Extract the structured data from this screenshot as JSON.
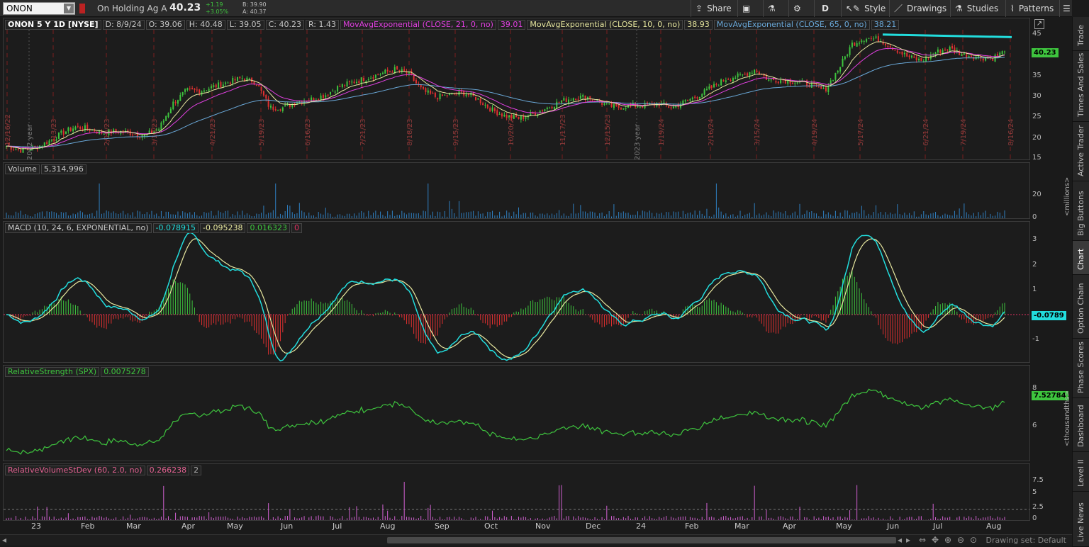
{
  "toolbar": {
    "symbol": "ONON",
    "company": "On Holding Ag A",
    "last": "40.23",
    "change": "+1.19",
    "change_pct": "+3.05%",
    "bid": "B: 39.90",
    "ask": "A: 40.37",
    "buttons": {
      "share": "Share",
      "period": "D",
      "style": "Style",
      "drawings": "Drawings",
      "studies": "Studies",
      "patterns": "Patterns"
    }
  },
  "side_tabs": [
    "Trade",
    "Times And Sales",
    "Active Trader",
    "Big Buttons",
    "Chart",
    "Option Chain",
    "Phase Scores",
    "Dashboard",
    "Level II",
    "Live News"
  ],
  "price_pane": {
    "header": {
      "title": "ONON 5 Y 1D [NYSE]",
      "date": "D: 8/9/24",
      "open": "O: 39.06",
      "high": "H: 40.48",
      "low": "L: 39.05",
      "close": "C: 40.23",
      "range": "R: 1.43",
      "ema21_label": "MovAvgExponential (CLOSE, 21, 0, no)",
      "ema21_value": "39.01",
      "ema10_label": "MovAvgExponential (CLOSE, 10, 0, no)",
      "ema10_value": "38.93",
      "ema65_label": "MovAvgExponential (CLOSE, 65, 0, no)",
      "ema65_value": "38.21"
    },
    "last_tag": "40.23",
    "y_ticks": [
      "45",
      "40",
      "35",
      "30",
      "25",
      "20",
      "15"
    ],
    "year_labels": [
      "2022 year",
      "2023 year"
    ],
    "date_markers": [
      "12/16/22",
      "1/13/23",
      "2/10/23",
      "3/10/23",
      "4/21/23",
      "5/19/23",
      "6/16/23",
      "7/21/23",
      "8/18/23",
      "9/15/23",
      "10/20/23",
      "11/17/23",
      "12/15/23",
      "1/19/24",
      "2/16/24",
      "3/15/24",
      "4/19/24",
      "5/17/24",
      "6/21/24",
      "7/19/24",
      "8/16/24"
    ],
    "colors": {
      "ema21": "#e040e0",
      "ema10": "#e8e8a0",
      "ema65": "#6aa8d8",
      "up": "#3ec43e",
      "down": "#e03030",
      "trendline": "#22dddd"
    }
  },
  "volume_pane": {
    "label": "Volume",
    "value": "5,314,996",
    "y_ticks": [
      "20",
      "0"
    ],
    "unit": "<millions>"
  },
  "macd_pane": {
    "label": "MACD (10, 24, 6, EXPONENTIAL, no)",
    "value": "-0.078915",
    "avg": "-0.095238",
    "diff": "0.016323",
    "zero": "0",
    "last_tag": "-0.0789",
    "y_ticks": [
      "3",
      "2",
      "1",
      "-1"
    ]
  },
  "rs_pane": {
    "label": "RelativeStrength (SPX)",
    "value": "0.0075278",
    "last_tag": "7.52784",
    "y_ticks": [
      "8",
      "6"
    ],
    "unit": "<thousandths>"
  },
  "rvol_pane": {
    "label": "RelativeVolumeStDev (60, 2.0, no)",
    "value": "0.266238",
    "threshold": "2",
    "y_ticks": [
      "7.5",
      "5",
      "2.5",
      "0"
    ]
  },
  "time_axis": [
    "23",
    "Feb",
    "Mar",
    "Apr",
    "May",
    "Jun",
    "Jul",
    "Aug",
    "Sep",
    "Oct",
    "Nov",
    "Dec",
    "24",
    "Feb",
    "Mar",
    "Apr",
    "May",
    "Jun",
    "Jul",
    "Aug"
  ],
  "footer": {
    "drawing_set": "Drawing set: Default"
  },
  "chart_data": {
    "type": "line",
    "series": [
      {
        "name": "ONON 5 Y 1D [NYSE]",
        "values": [
          18,
          17,
          17.5,
          19,
          21,
          22.5,
          22,
          21,
          21.5,
          21,
          20.5,
          22,
          28,
          31,
          31,
          32,
          33,
          34,
          33,
          27,
          27,
          28.5,
          29,
          30,
          32,
          33,
          34,
          35,
          36,
          35,
          31,
          29.5,
          30,
          30.5,
          29,
          26.5,
          25,
          24.5,
          25.5,
          27,
          28.5,
          29.5,
          29.5,
          28,
          27,
          27.5,
          27.5,
          28,
          27,
          28.5,
          30,
          32,
          34,
          34.5,
          36,
          33.5,
          33.5,
          33,
          32.5,
          31,
          36,
          42,
          43.5,
          43,
          41,
          39,
          38,
          40,
          41,
          39.5,
          39,
          38.5,
          40.23
        ]
      }
    ],
    "ylim": [
      15,
      45
    ]
  }
}
